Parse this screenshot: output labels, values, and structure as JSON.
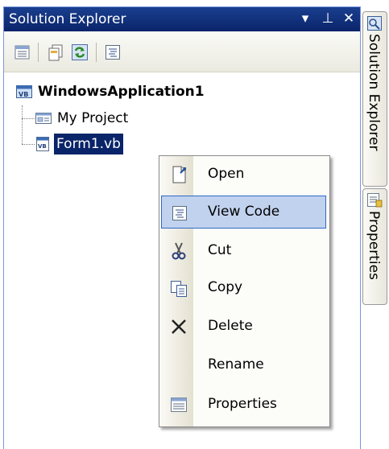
{
  "panel": {
    "title": "Solution Explorer",
    "title_buttons": [
      "▾",
      "⊥",
      "✕"
    ]
  },
  "toolbar": {
    "buttons": [
      "properties-icon",
      "show-all-files-icon",
      "refresh-icon",
      "view-code-icon"
    ]
  },
  "tree": {
    "project": {
      "label": "WindowsApplication1",
      "icon": "vb-project-icon"
    },
    "items": [
      {
        "label": "My Project",
        "icon": "my-project-icon"
      },
      {
        "label": "Form1.vb",
        "icon": "vb-form-icon",
        "selected": true
      }
    ]
  },
  "side_tabs": [
    {
      "label": "Solution Explorer",
      "icon": "solution-explorer-icon"
    },
    {
      "label": "Properties",
      "icon": "properties-icon"
    }
  ],
  "context_menu": {
    "items": [
      {
        "label": "Open",
        "icon": "open-icon"
      },
      {
        "label": "View Code",
        "icon": "view-code-icon",
        "highlighted": true
      },
      {
        "label": "Cut",
        "icon": "scissors-icon"
      },
      {
        "label": "Copy",
        "icon": "copy-icon"
      },
      {
        "label": "Delete",
        "icon": "delete-icon"
      },
      {
        "label": "Rename",
        "icon": ""
      },
      {
        "label": "Properties",
        "icon": "properties-icon"
      }
    ]
  },
  "colors": {
    "title_bar": "#0a246a",
    "selection": "#0a246a",
    "menu_highlight": "#c1d2ee",
    "menu_highlight_border": "#316ac5"
  }
}
